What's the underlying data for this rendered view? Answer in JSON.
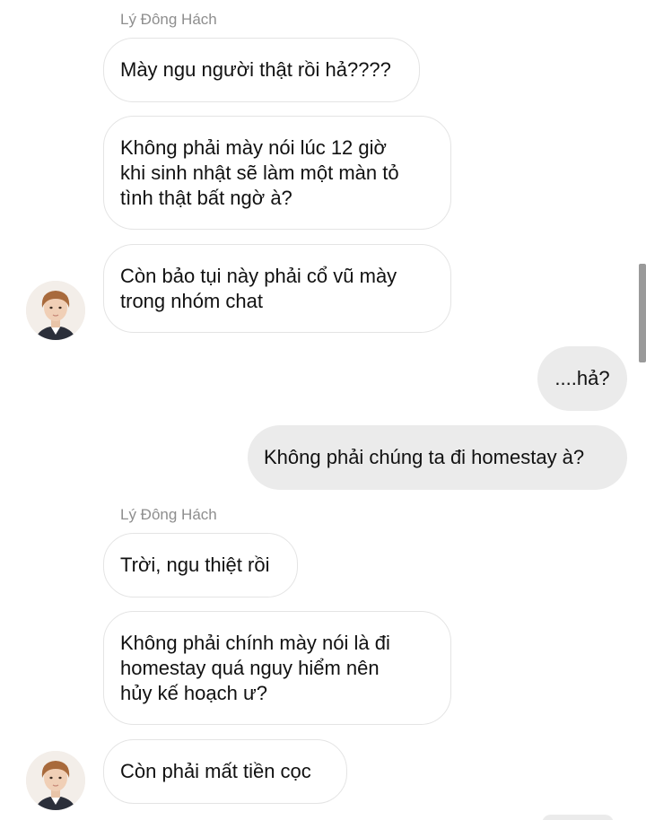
{
  "thread": {
    "contact_name": "Lý Đông Hách",
    "groups": [
      {
        "sender": "Lý Đông Hách",
        "messages": [
          "Mày ngu người thật rồi hả????",
          "Không phải mày nói lúc 12 giờ\nkhi sinh nhật sẽ làm một màn tỏ\ntình thật bất ngờ à?",
          "Còn bảo tụi này phải cổ vũ mày\ntrong nhóm chat"
        ]
      },
      {
        "sender": "me",
        "messages": [
          "....hả?",
          "Không phải chúng ta đi homestay à?"
        ]
      },
      {
        "sender": "Lý Đông Hách",
        "messages": [
          "Trời, ngu thiệt rồi",
          "Không phải chính mày nói là đi\nhomestay quá nguy hiểm nên\nhủy kế hoạch ư?",
          "Còn phải mất tiền cọc"
        ]
      }
    ]
  },
  "colors": {
    "incoming_bubble_bg": "#ffffff",
    "incoming_bubble_border": "#e4e4e4",
    "outgoing_bubble_bg": "#ebebeb",
    "sender_name": "#8e8e8e",
    "text": "#111111"
  },
  "icons": {
    "avatar": "contact-avatar-photo"
  }
}
